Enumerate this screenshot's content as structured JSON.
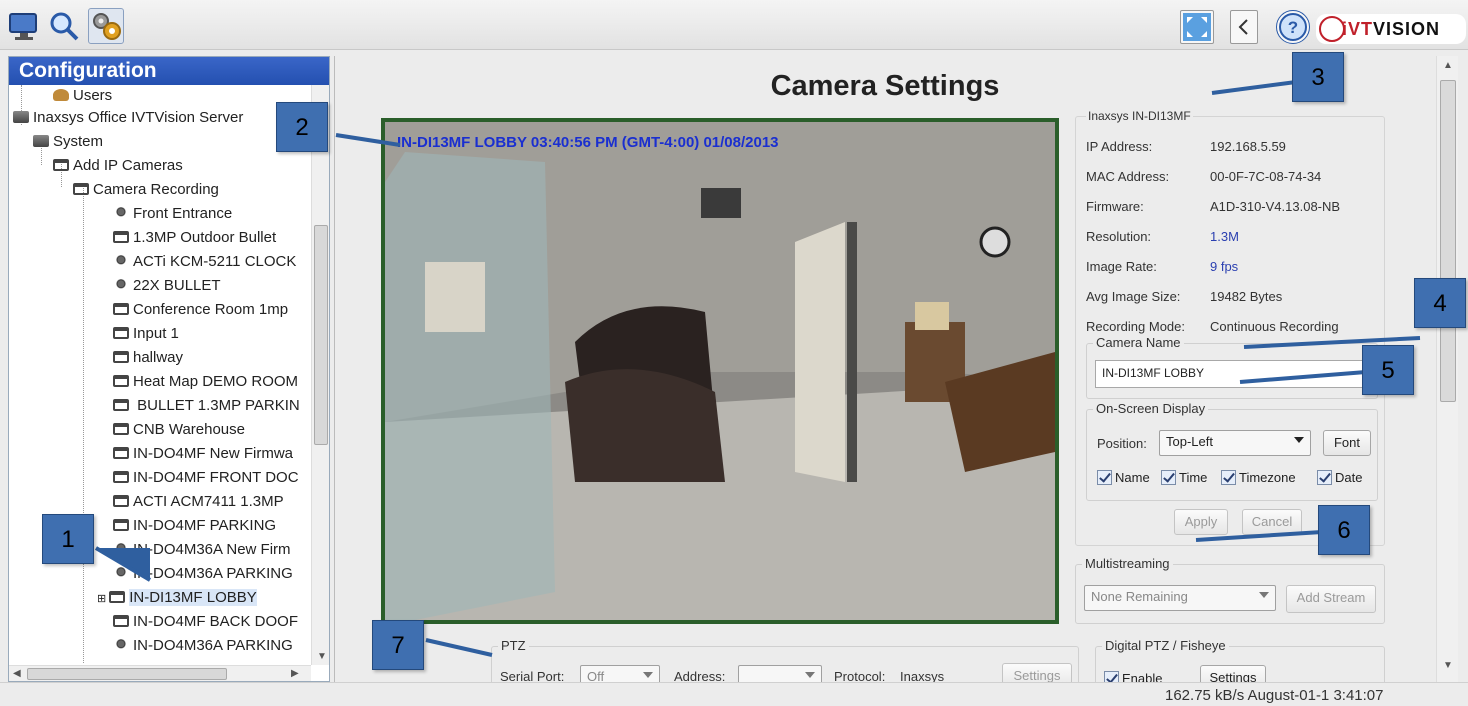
{
  "toolbar": {
    "buttons": [
      "monitor-icon",
      "search-icon",
      "settings-gears-icon"
    ],
    "right_buttons": [
      "fullscreen-icon",
      "back-icon",
      "help-icon"
    ],
    "logo": {
      "prefix": "i",
      "mid": "VT",
      "suffix": "VISION"
    }
  },
  "sidebar": {
    "title": "Configuration",
    "tree": {
      "users": "Users",
      "server": "Inaxsys Office IVTVision Server",
      "system": "System",
      "add_ip_cameras": "Add IP Cameras",
      "camera_recording": "Camera Recording",
      "cameras": [
        "Front Entrance",
        "1.3MP Outdoor Bullet",
        "ACTi KCM-5211 CLOCK",
        "22X BULLET",
        "Conference Room 1mp",
        "Input 1",
        "hallway",
        "Heat Map DEMO ROOM",
        " BULLET 1.3MP PARKIN",
        "CNB Warehouse",
        "IN-DO4MF New Firmwa",
        "IN-DO4MF FRONT DOC",
        "ACTI ACM7411 1.3MP",
        "IN-DO4MF PARKING",
        "IN-DO4M36A New Firm",
        "IN-DO4M36A PARKING",
        "IN-DI13MF LOBBY",
        "IN-DO4MF BACK DOOF",
        "IN-DO4M36A PARKING"
      ],
      "selected_index": 16
    }
  },
  "main": {
    "title": "Camera Settings",
    "video": {
      "osd_text": "IN-DI13MF LOBBY 03:40:56 PM (GMT-4:00) 01/08/2013"
    },
    "info": {
      "title": "Inaxsys IN-DI13MF",
      "rows": [
        {
          "key": "IP Address:",
          "value": "192.168.5.59"
        },
        {
          "key": "MAC Address:",
          "value": "00-0F-7C-08-74-34"
        },
        {
          "key": "Firmware:",
          "value": "A1D-310-V4.13.08-NB"
        },
        {
          "key": "Resolution:",
          "value": "1.3M"
        },
        {
          "key": "Image Rate:",
          "value": "9 fps"
        },
        {
          "key": "Avg Image Size:",
          "value": "19482 Bytes"
        },
        {
          "key": "Recording Mode:",
          "value": "Continuous Recording"
        }
      ],
      "highlight_color": "#2a3fb0"
    },
    "camera_name": {
      "label": "Camera Name",
      "value": "IN-DI13MF LOBBY"
    },
    "osd": {
      "label": "On-Screen Display",
      "position_label": "Position:",
      "position_value": "Top-Left",
      "font_button": "Font",
      "checks": [
        {
          "label": "Name",
          "checked": true
        },
        {
          "label": "Time",
          "checked": true
        },
        {
          "label": "Timezone",
          "checked": true
        },
        {
          "label": "Date",
          "checked": true
        }
      ]
    },
    "apply_button": "Apply",
    "cancel_button": "Cancel",
    "multistreaming": {
      "label": "Multistreaming",
      "select_value": "None Remaining",
      "add_button": "Add Stream"
    },
    "ptz": {
      "label": "PTZ",
      "serial_port_label": "Serial Port:",
      "serial_port_value": "Off",
      "address_label": "Address:",
      "address_value": "",
      "protocol_label": "Protocol:",
      "protocol_value": "Inaxsys",
      "settings_button": "Settings"
    },
    "digital_ptz": {
      "label": "Digital PTZ / Fisheye",
      "enable_label": "Enable",
      "settings_button": "Settings"
    }
  },
  "status": {
    "text": "162.75 kB/s August-01-1  3:41:07"
  },
  "callouts": [
    "1",
    "2",
    "3",
    "4",
    "5",
    "6",
    "7"
  ],
  "colors": {
    "accent": "#2450b0",
    "callout": "#3f6fb0",
    "video_border": "#2a5e2a",
    "osd_text": "#1a2fd0"
  }
}
